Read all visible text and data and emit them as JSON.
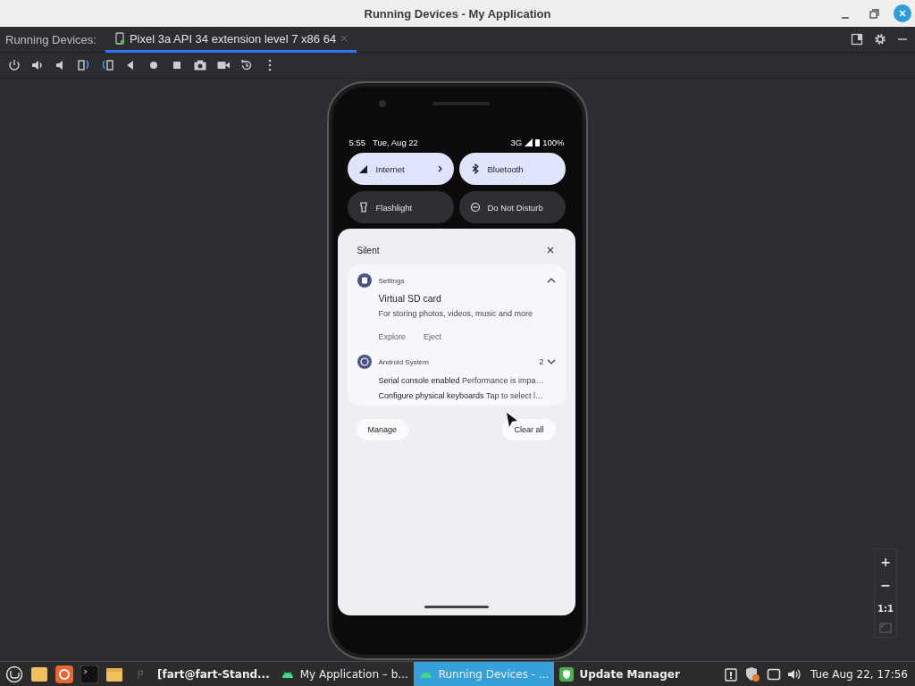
{
  "window": {
    "title": "Running Devices - My Application"
  },
  "tool_window": {
    "label": "Running Devices:",
    "tabs": [
      {
        "label": "Pixel 3a API 34 extension level 7 x86 64",
        "selected": true
      }
    ]
  },
  "phone": {
    "status_bar": {
      "time": "5:55",
      "date": "Tue, Aug 22",
      "network": "3G",
      "battery": "100%"
    },
    "quick_tiles": [
      {
        "kind": "internet",
        "label": "Internet",
        "on": true
      },
      {
        "kind": "bluetooth",
        "label": "Bluetooth",
        "on": true
      },
      {
        "kind": "flashlight",
        "label": "Flashlight",
        "on": false
      },
      {
        "kind": "dnd",
        "label": "Do Not Disturb",
        "on": false
      }
    ],
    "notifications": {
      "header": "Silent",
      "groups": [
        {
          "app": "Settings",
          "expanded": true,
          "title": "Virtual SD card",
          "text": "For storing photos, videos, music and more",
          "actions": [
            "Explore",
            "Eject"
          ]
        },
        {
          "app": "Android System",
          "count": "2",
          "expanded": false,
          "items": [
            {
              "title": "Serial console enabled",
              "text": "Performance is impa…"
            },
            {
              "title": "Configure physical keyboards",
              "text": "Tap to select l…"
            }
          ]
        }
      ],
      "buttons": [
        "Manage",
        "Clear all"
      ]
    }
  },
  "zoom_controls": {
    "buttons": [
      "+",
      "−",
      "1:1"
    ]
  },
  "taskbar": {
    "apps": [
      {
        "kind": "terminal",
        "label": "[fart@fart-Stand...",
        "selected": false
      },
      {
        "kind": "android",
        "label": "My Application – b...",
        "selected": false
      },
      {
        "kind": "android",
        "label": "Running Devices - ...",
        "selected": true
      },
      {
        "kind": "shield",
        "label": "Update Manager",
        "selected": false
      }
    ],
    "clock": "Tue Aug 22, 17:56"
  }
}
